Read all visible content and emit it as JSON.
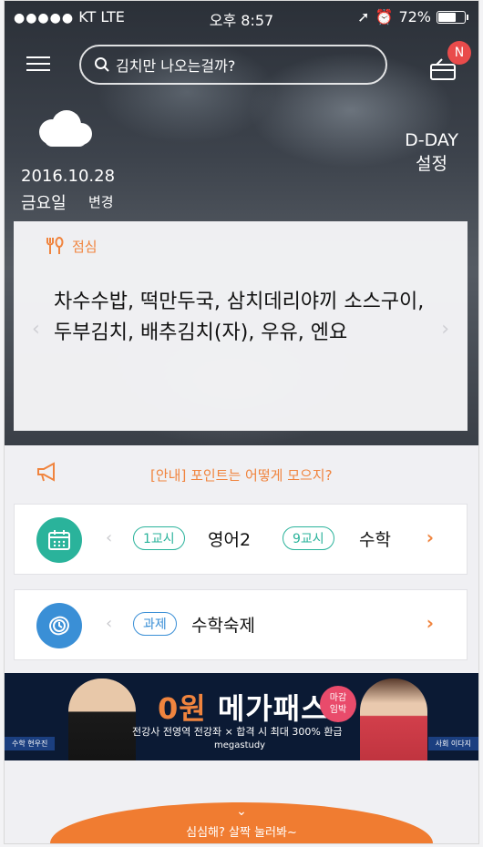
{
  "status_bar": {
    "carrier": "KT",
    "network": "LTE",
    "time": "오후 8:57",
    "battery": "72%",
    "battery_level": 0.72
  },
  "header": {
    "search_placeholder": "김치만 나오는걸까?",
    "notification_badge": "N"
  },
  "weather": {
    "icon": "cloud-icon",
    "date": "2016.10.28",
    "day": "금요일",
    "change_label": "변경"
  },
  "dday": {
    "line1": "D-DAY",
    "line2": "설정"
  },
  "meal": {
    "icon": "fork-spoon-icon",
    "label": "점심",
    "menu": "차수수밥, 떡만두국, 삼치데리야끼 소스구이, 두부김치, 배추김치(자), 우유, 엔요"
  },
  "notice": {
    "icon": "megaphone-icon",
    "text": "[안내] 포인트는 어떻게 모으지?"
  },
  "timetable": {
    "icon": "calendar-icon",
    "period1": "1교시",
    "subject1": "영어2",
    "period2": "9교시",
    "subject2": "수학",
    "prev": "‹",
    "next": "›"
  },
  "homework": {
    "icon": "clock-icon",
    "tag": "과제",
    "subject": "수학숙제",
    "prev": "‹",
    "next": "›"
  },
  "banner": {
    "zero": "0원",
    "title": "메가패스",
    "tag_line1": "마감",
    "tag_line2": "임박",
    "sub": "전강사 전영역 전강좌 × 합격 시 최대 300% 환급",
    "brand": "megastudy",
    "label_left": "수학 현우진",
    "label_right": "사회 이다지"
  },
  "pull_up": {
    "icon": "chevron-down-icon",
    "text": "심심해? 살짝 눌러봐~"
  },
  "colors": {
    "accent": "#f0843e",
    "teal": "#2ab39b",
    "blue": "#3a8fd6"
  }
}
